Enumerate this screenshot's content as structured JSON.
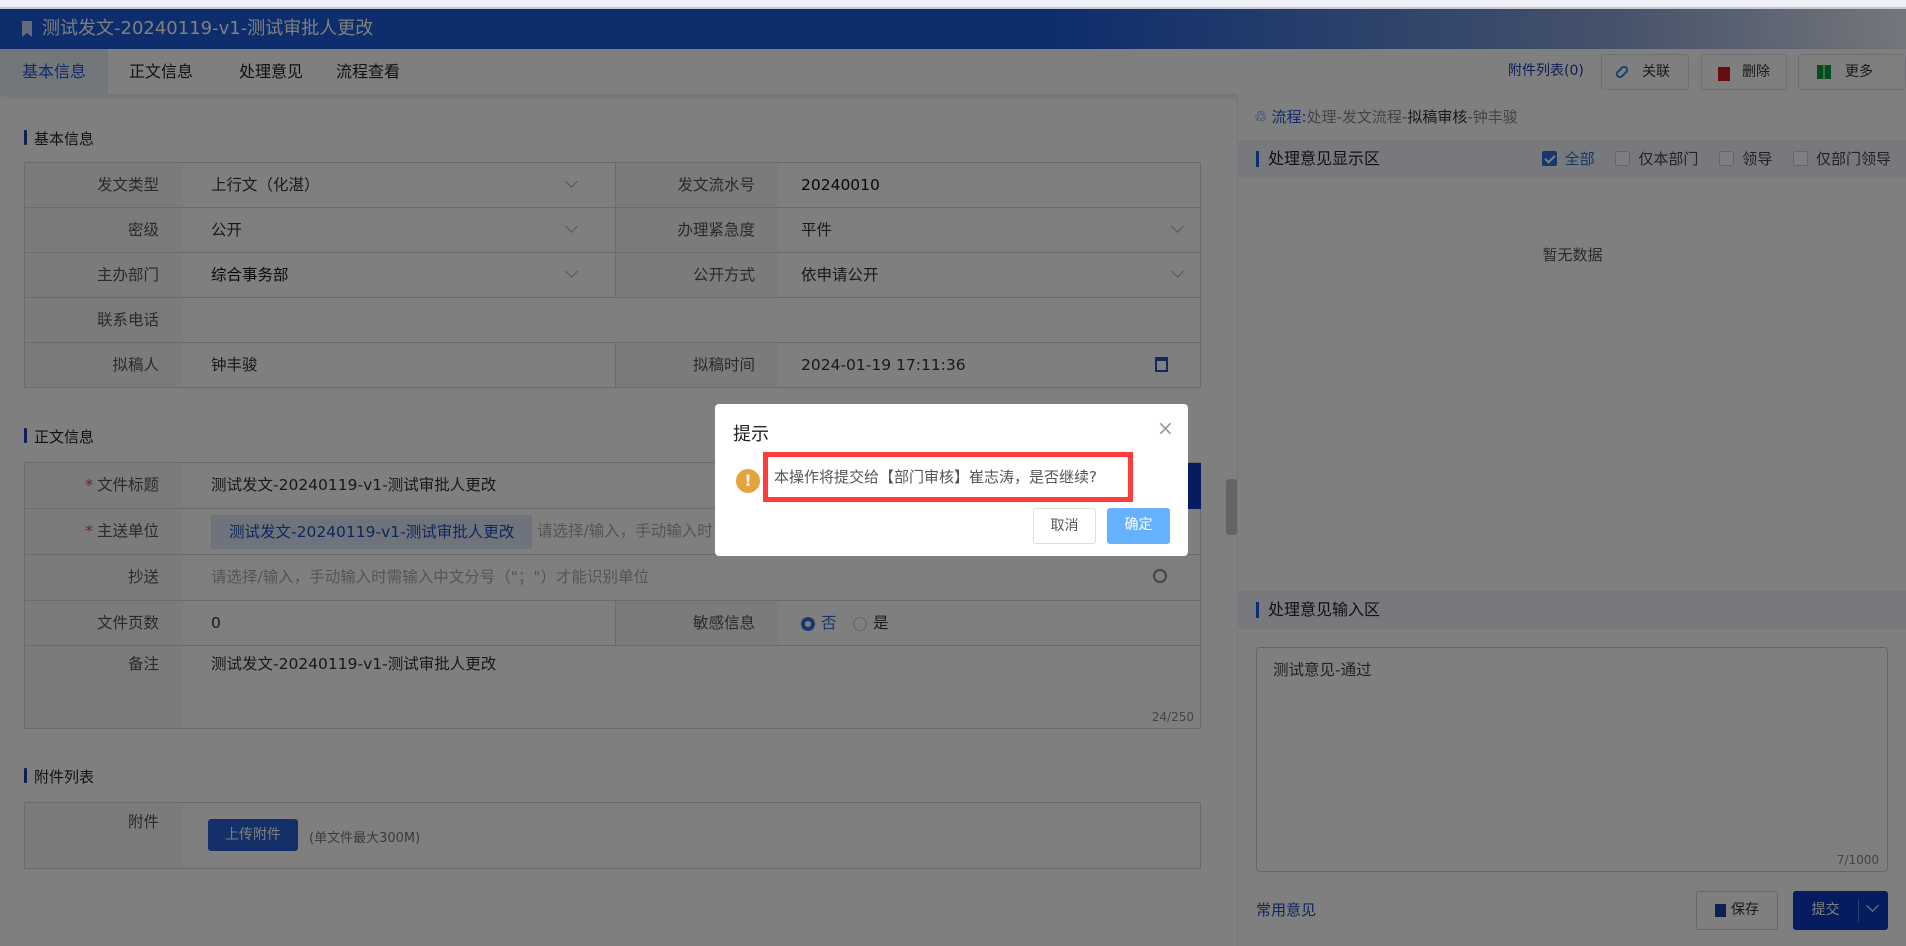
{
  "header": {
    "title": "测试发文-20240119-v1-测试审批人更改",
    "icon": "bookmark-icon"
  },
  "tabs": [
    {
      "label": "基本信息",
      "active": true
    },
    {
      "label": "正文信息"
    },
    {
      "label": "处理意见"
    },
    {
      "label": "流程查看"
    }
  ],
  "toolbar": {
    "attachments_link": "附件列表(0)",
    "link_label": "关联",
    "delete_label": "删除",
    "more_label": "更多"
  },
  "basic": {
    "title": "基本信息",
    "fields": {
      "doc_type_label": "发文类型",
      "doc_type": "上行文（化湛）",
      "serial_label": "发文流水号",
      "serial": "20240010",
      "secret_label": "密级",
      "secret": "公开",
      "urgency_label": "办理紧急度",
      "urgency": "平件",
      "dept_label": "主办部门",
      "dept": "综合事务部",
      "publish_label": "公开方式",
      "publish": "依申请公开",
      "phone_label": "联系电话",
      "phone": "",
      "drafter_label": "拟稿人",
      "drafter": "钟丰骏",
      "draft_time_label": "拟稿时间",
      "draft_time": "2024-01-19 17:11:36"
    }
  },
  "body": {
    "title": "正文信息",
    "doc_title_label": "文件标题",
    "doc_title": "测试发文-20240119-v1-测试审批人更改",
    "main_to_label": "主送单位",
    "main_to_tag": "测试发文-20240119-v1-测试审批人更改",
    "main_to_placeholder": "请选择/输入，手动输入时",
    "cc_label": "抄送",
    "cc_placeholder": "请选择/输入，手动输入时需输入中文分号（\"；\"）才能识别单位",
    "pages_label": "文件页数",
    "pages": "0",
    "sensitive_label": "敏感信息",
    "sensitive_no": "否",
    "sensitive_yes": "是",
    "sensitive_value": "否",
    "remark_label": "备注",
    "remark": "测试发文-20240119-v1-测试审批人更改",
    "remark_count": "24/250"
  },
  "attach": {
    "title": "附件列表",
    "label": "附件",
    "upload_label": "上传附件",
    "hint": "(单文件最大300M)"
  },
  "right": {
    "flow_prefix": "流程:",
    "flow_a": "处理-发文流程-",
    "flow_b": "拟稿审核",
    "flow_c": "-钟丰骏",
    "display_title": "处理意见显示区",
    "filters": [
      {
        "label": "全部",
        "checked": true
      },
      {
        "label": "仅本部门",
        "checked": false
      },
      {
        "label": "领导",
        "checked": false
      },
      {
        "label": "仅部门领导",
        "checked": false
      }
    ],
    "empty": "暂无数据",
    "input_title": "处理意见输入区",
    "opinion": "测试意见-通过",
    "opinion_count": "7/1000",
    "common_label": "常用意见",
    "save_label": "保存",
    "submit_label": "提交"
  },
  "dialog": {
    "title": "提示",
    "message": "本操作将提交给【部门审核】崔志涛，是否继续?",
    "cancel": "取消",
    "confirm": "确定"
  },
  "colors": {
    "brand": "#1a5ad8",
    "highlight": "#ff3b3b",
    "warning": "#e6a23c",
    "confirm": "#66b1ff"
  }
}
